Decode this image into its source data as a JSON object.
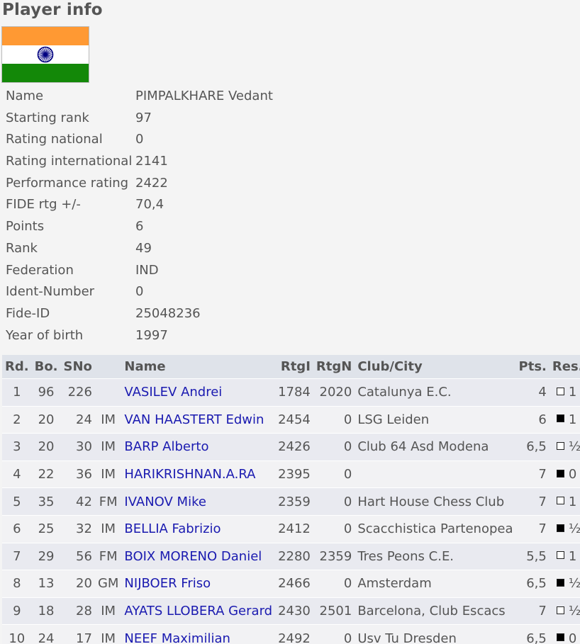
{
  "page": {
    "title": "Player info"
  },
  "flag": {
    "country": "IND",
    "colors": [
      "#ff9933",
      "#ffffff",
      "#138808"
    ],
    "chakra_color": "#000080"
  },
  "info": [
    {
      "label": "Name",
      "value": "PIMPALKHARE Vedant"
    },
    {
      "label": "Starting rank",
      "value": "97"
    },
    {
      "label": "Rating national",
      "value": "0"
    },
    {
      "label": "Rating international",
      "value": "2141"
    },
    {
      "label": "Performance rating",
      "value": "2422"
    },
    {
      "label": "FIDE rtg +/-",
      "value": "70,4"
    },
    {
      "label": "Points",
      "value": "6"
    },
    {
      "label": "Rank",
      "value": "49"
    },
    {
      "label": "Federation",
      "value": "IND"
    },
    {
      "label": "Ident-Number",
      "value": "0"
    },
    {
      "label": "Fide-ID",
      "value": "25048236"
    },
    {
      "label": "Year of birth",
      "value": "1997"
    }
  ],
  "table": {
    "headers": {
      "rd": "Rd.",
      "bo": "Bo.",
      "sno": "SNo",
      "title": "",
      "name": "Name",
      "rtgi": "RtgI",
      "rtgn": "RtgN",
      "club": "Club/City",
      "pts": "Pts.",
      "res": "Res."
    },
    "rows": [
      {
        "rd": "1",
        "bo": "96",
        "sno": "226",
        "title": "",
        "name": "VASILEV Andrei",
        "rtgi": "1784",
        "rtgn": "2020",
        "club": "Catalunya E.C.",
        "pts": "4",
        "color": "white",
        "res": "1"
      },
      {
        "rd": "2",
        "bo": "20",
        "sno": "24",
        "title": "IM",
        "name": "VAN HAASTERT Edwin",
        "rtgi": "2454",
        "rtgn": "0",
        "club": "LSG Leiden",
        "pts": "6",
        "color": "black",
        "res": "1"
      },
      {
        "rd": "3",
        "bo": "20",
        "sno": "30",
        "title": "IM",
        "name": "BARP Alberto",
        "rtgi": "2426",
        "rtgn": "0",
        "club": "Club 64 Asd Modena",
        "pts": "6,5",
        "color": "white",
        "res": "½"
      },
      {
        "rd": "4",
        "bo": "22",
        "sno": "36",
        "title": "IM",
        "name": "HARIKRISHNAN.A.RA",
        "rtgi": "2395",
        "rtgn": "0",
        "club": "",
        "pts": "7",
        "color": "black",
        "res": "0"
      },
      {
        "rd": "5",
        "bo": "35",
        "sno": "42",
        "title": "FM",
        "name": "IVANOV Mike",
        "rtgi": "2359",
        "rtgn": "0",
        "club": "Hart House Chess Club",
        "pts": "7",
        "color": "white",
        "res": "1"
      },
      {
        "rd": "6",
        "bo": "25",
        "sno": "32",
        "title": "IM",
        "name": "BELLIA Fabrizio",
        "rtgi": "2412",
        "rtgn": "0",
        "club": "Scacchistica Partenopea",
        "pts": "7",
        "color": "black",
        "res": "½"
      },
      {
        "rd": "7",
        "bo": "29",
        "sno": "56",
        "title": "FM",
        "name": "BOIX MORENO Daniel",
        "rtgi": "2280",
        "rtgn": "2359",
        "club": "Tres Peons C.E.",
        "pts": "5,5",
        "color": "white",
        "res": "1"
      },
      {
        "rd": "8",
        "bo": "13",
        "sno": "20",
        "title": "GM",
        "name": "NIJBOER Friso",
        "rtgi": "2466",
        "rtgn": "0",
        "club": "Amsterdam",
        "pts": "6,5",
        "color": "black",
        "res": "½"
      },
      {
        "rd": "9",
        "bo": "18",
        "sno": "28",
        "title": "IM",
        "name": "AYATS LLOBERA Gerard",
        "rtgi": "2430",
        "rtgn": "2501",
        "club": "Barcelona, Club Escacs",
        "pts": "7",
        "color": "white",
        "res": "½"
      },
      {
        "rd": "10",
        "bo": "24",
        "sno": "17",
        "title": "IM",
        "name": "NEEF Maximilian",
        "rtgi": "2492",
        "rtgn": "0",
        "club": "Usv Tu Dresden",
        "pts": "6,5",
        "color": "black",
        "res": "0"
      }
    ]
  }
}
